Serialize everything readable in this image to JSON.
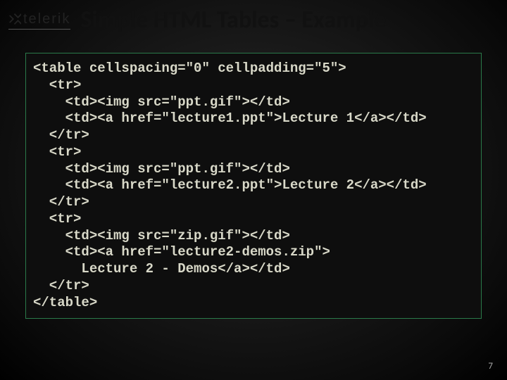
{
  "logo": {
    "brand": "telerik"
  },
  "slide": {
    "title": "Simple HTML Tables – Example",
    "page_number": "7"
  },
  "code": {
    "lines": [
      "<table cellspacing=\"0\" cellpadding=\"5\">",
      "  <tr>",
      "    <td><img src=\"ppt.gif\"></td>",
      "    <td><a href=\"lecture1.ppt\">Lecture 1</a></td>",
      "  </tr>",
      "  <tr>",
      "    <td><img src=\"ppt.gif\"></td>",
      "    <td><a href=\"lecture2.ppt\">Lecture 2</a></td>",
      "  </tr>",
      "  <tr>",
      "    <td><img src=\"zip.gif\"></td>",
      "    <td><a href=\"lecture2-demos.zip\">",
      "      Lecture 2 - Demos</a></td>",
      "  </tr>",
      "</table>"
    ]
  }
}
